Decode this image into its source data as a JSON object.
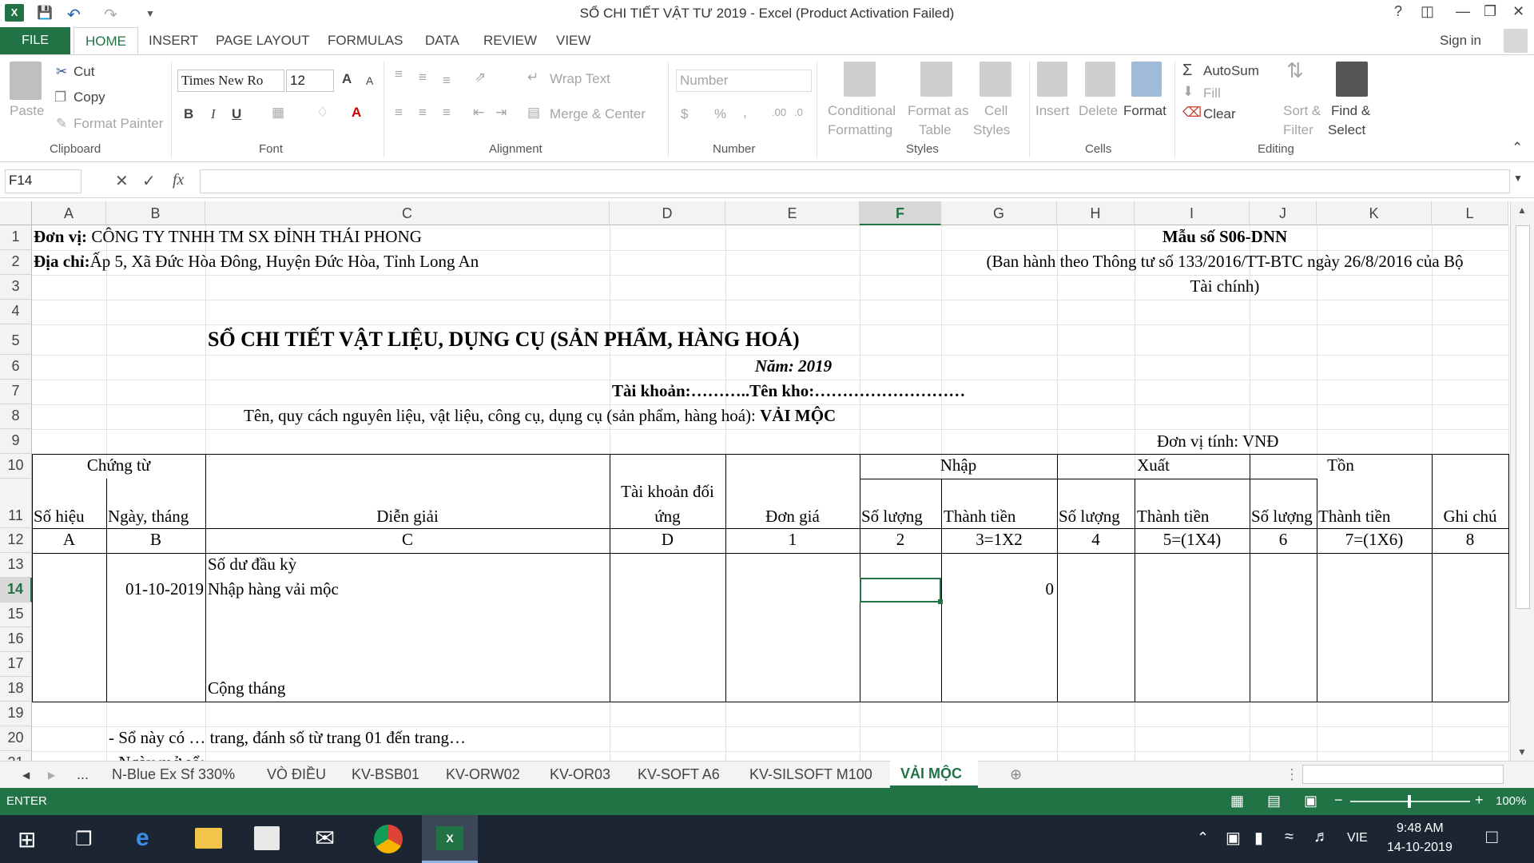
{
  "window": {
    "title": "SỔ CHI TIẾT VẬT TƯ 2019 - Excel (Product Activation Failed)",
    "help": "?",
    "signin": "Sign in"
  },
  "ribbon_tabs": [
    "FILE",
    "HOME",
    "INSERT",
    "PAGE LAYOUT",
    "FORMULAS",
    "DATA",
    "REVIEW",
    "VIEW"
  ],
  "clipboard": {
    "paste": "Paste",
    "cut": "Cut",
    "copy": "Copy",
    "format_painter": "Format Painter",
    "group": "Clipboard"
  },
  "font": {
    "name": "Times New Ro",
    "size": "12",
    "bold": "B",
    "italic": "I",
    "underline": "U",
    "group": "Font",
    "grow": "A",
    "shrink": "A"
  },
  "alignment": {
    "wrap": "Wrap Text",
    "merge": "Merge & Center",
    "group": "Alignment"
  },
  "number": {
    "format": "Number",
    "currency": "$",
    "percent": "%",
    "comma": ",",
    "group": "Number"
  },
  "styles": {
    "conditional_1": "Conditional",
    "conditional_2": "Formatting",
    "format_as_1": "Format as",
    "format_as_2": "Table",
    "cell_1": "Cell",
    "cell_2": "Styles",
    "group": "Styles"
  },
  "cells": {
    "insert": "Insert",
    "delete": "Delete",
    "format": "Format",
    "group": "Cells"
  },
  "editing": {
    "autosum": "AutoSum",
    "fill": "Fill",
    "clear": "Clear",
    "sort_1": "Sort &",
    "sort_2": "Filter",
    "find_1": "Find &",
    "find_2": "Select",
    "group": "Editing"
  },
  "formula_bar": {
    "name_box": "F14",
    "fx": "fx",
    "value": ""
  },
  "columns": [
    "A",
    "B",
    "C",
    "D",
    "E",
    "F",
    "G",
    "H",
    "I",
    "J",
    "K",
    "L"
  ],
  "rows": [
    "1",
    "2",
    "3",
    "4",
    "5",
    "6",
    "7",
    "8",
    "9",
    "10",
    "11",
    "12",
    "13",
    "14",
    "15",
    "16",
    "17",
    "18",
    "19",
    "20",
    "21"
  ],
  "sheet": {
    "r1_label": "Đơn vị:",
    "r1_value": " CÔNG TY TNHH TM SX ĐỈNH THÁI PHONG",
    "r2_label": "Địa chỉ:",
    "r2_value": "Ấp 5, Xã Đức Hòa Đông, Huyện Đức Hòa, Tỉnh Long An",
    "form_no": "Mẫu số S06-DNN",
    "issued_1": "(Ban hành theo Thông tư số 133/2016/TT-BTC ngày 26/8/2016 của Bộ",
    "issued_2": "Tài chính)",
    "title": "SỔ CHI TIẾT VẬT LIỆU, DỤNG CỤ (SẢN PHẨM, HÀNG HOÁ)",
    "year": "Năm: 2019",
    "account": "Tài khoản:………..Tên kho:………………………",
    "item_label": "Tên, quy cách nguyên liệu, vật liệu, công cụ, dụng cụ (sản phẩm, hàng hoá): ",
    "item_value": "VẢI MỘC",
    "unit": "Đơn vị tính: VNĐ",
    "h_chungtu": "Chứng từ",
    "h_nhap": "Nhập",
    "h_xuat": "Xuất",
    "h_ton": "Tồn",
    "h_sohieu": "Số hiệu",
    "h_ngay": "Ngày, tháng",
    "h_diengiai": "Diễn giải",
    "h_tk_1": "Tài khoản đối",
    "h_tk_2": "ứng",
    "h_dongia": "Đơn giá",
    "h_sl1": "Số lượng",
    "h_tt1": "Thành tiền",
    "h_sl2": "Số lượng",
    "h_tt2": "Thành tiền",
    "h_sl3": "Số lượng",
    "h_tt3": "Thành tiền",
    "h_ghichu": "Ghi chú",
    "idx": [
      "A",
      "B",
      "C",
      "D",
      "1",
      "2",
      "3=1X2",
      "4",
      "5=(1X4)",
      "6",
      "7=(1X6)",
      "8"
    ],
    "r13_c": "Số dư đầu kỳ",
    "r14_b": "01-10-2019",
    "r14_c": "Nhập hàng vải mộc",
    "r14_g": "0",
    "r18_c": "Cộng tháng",
    "r20_b": "- Sổ này có … trang, đánh số từ trang 01 đến trang…",
    "r21_b": "- Ngày mở sổ:…"
  },
  "sheet_tabs": [
    "...",
    "N-Blue Ex Sf 330%",
    "VÒ ĐIỀU",
    "KV-BSB01",
    "KV-ORW02",
    "KV-OR03",
    "KV-SOFT A6",
    "KV-SILSOFT M100",
    "VẢI MỘC"
  ],
  "status": {
    "mode": "ENTER",
    "zoom": "100%"
  },
  "taskbar": {
    "lang": "VIE",
    "time": "9:48 AM",
    "date": "14-10-2019"
  },
  "colors": {
    "excel_green": "#217346",
    "taskbar": "#1c2633"
  }
}
